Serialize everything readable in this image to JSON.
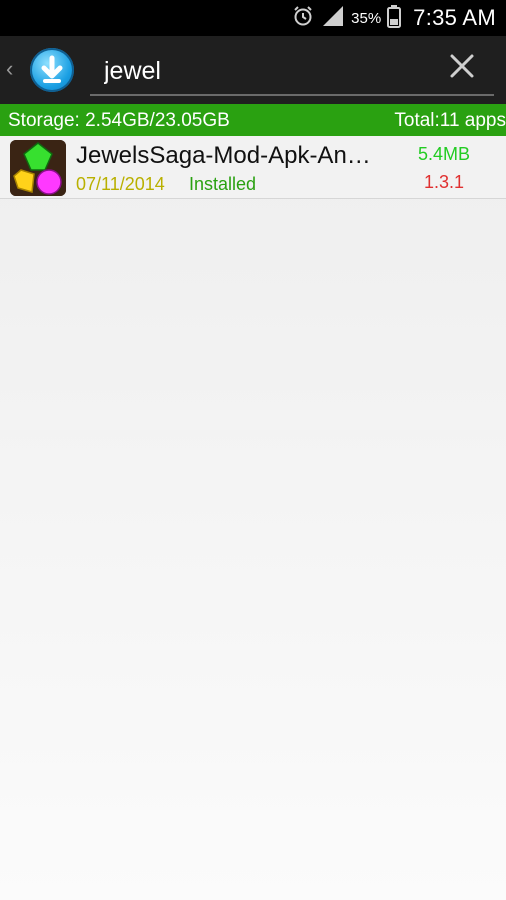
{
  "status_bar": {
    "battery_percent": "35%",
    "time": "7:35 AM",
    "icons": [
      "alarm-icon",
      "signal-icon",
      "battery-icon"
    ]
  },
  "toolbar": {
    "back_glyph": "‹",
    "app_icon": "download-icon",
    "search_value": "jewel",
    "clear_icon": "close-icon"
  },
  "storage": {
    "left_text": "Storage: 2.54GB/23.05GB",
    "right_text": "Total:11 apps",
    "color": "#2aa111"
  },
  "apps": [
    {
      "name": "JewelsSaga-Mod-Apk-An…",
      "date": "07/11/2014",
      "status": "Installed",
      "size": "5.4MB",
      "version": "1.3.1"
    }
  ]
}
